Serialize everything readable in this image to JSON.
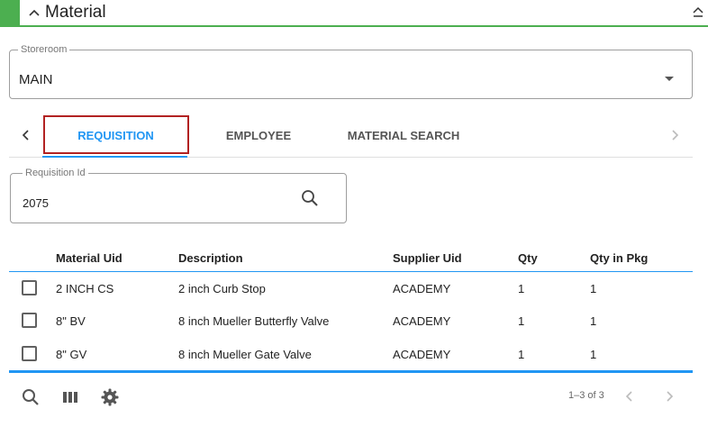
{
  "section": {
    "title": "Material"
  },
  "storeroom": {
    "label": "Storeroom",
    "value": "MAIN"
  },
  "tabs": [
    {
      "label": "REQUISITION",
      "active": true
    },
    {
      "label": "EMPLOYEE",
      "active": false
    },
    {
      "label": "MATERIAL SEARCH",
      "active": false
    }
  ],
  "requisition": {
    "label": "Requisition Id",
    "value": "2075"
  },
  "table": {
    "columns": [
      "Material Uid",
      "Description",
      "Supplier Uid",
      "Qty",
      "Qty in Pkg"
    ],
    "rows": [
      {
        "material_uid": "2 INCH CS",
        "description": "2 inch Curb Stop",
        "supplier_uid": "ACADEMY",
        "qty": "1",
        "qty_in_pkg": "1"
      },
      {
        "material_uid": "8\" BV",
        "description": "8 inch Mueller Butterfly Valve",
        "supplier_uid": "ACADEMY",
        "qty": "1",
        "qty_in_pkg": "1"
      },
      {
        "material_uid": "8\" GV",
        "description": "8 inch Mueller Gate Valve",
        "supplier_uid": "ACADEMY",
        "qty": "1",
        "qty_in_pkg": "1"
      }
    ]
  },
  "footer": {
    "pagination": "1–3 of 3",
    "icons": [
      "search-icon",
      "columns-icon",
      "settings-icon"
    ]
  },
  "colors": {
    "accent": "#4caf50",
    "primary": "#2196f3",
    "focus_outline": "#b22222"
  }
}
